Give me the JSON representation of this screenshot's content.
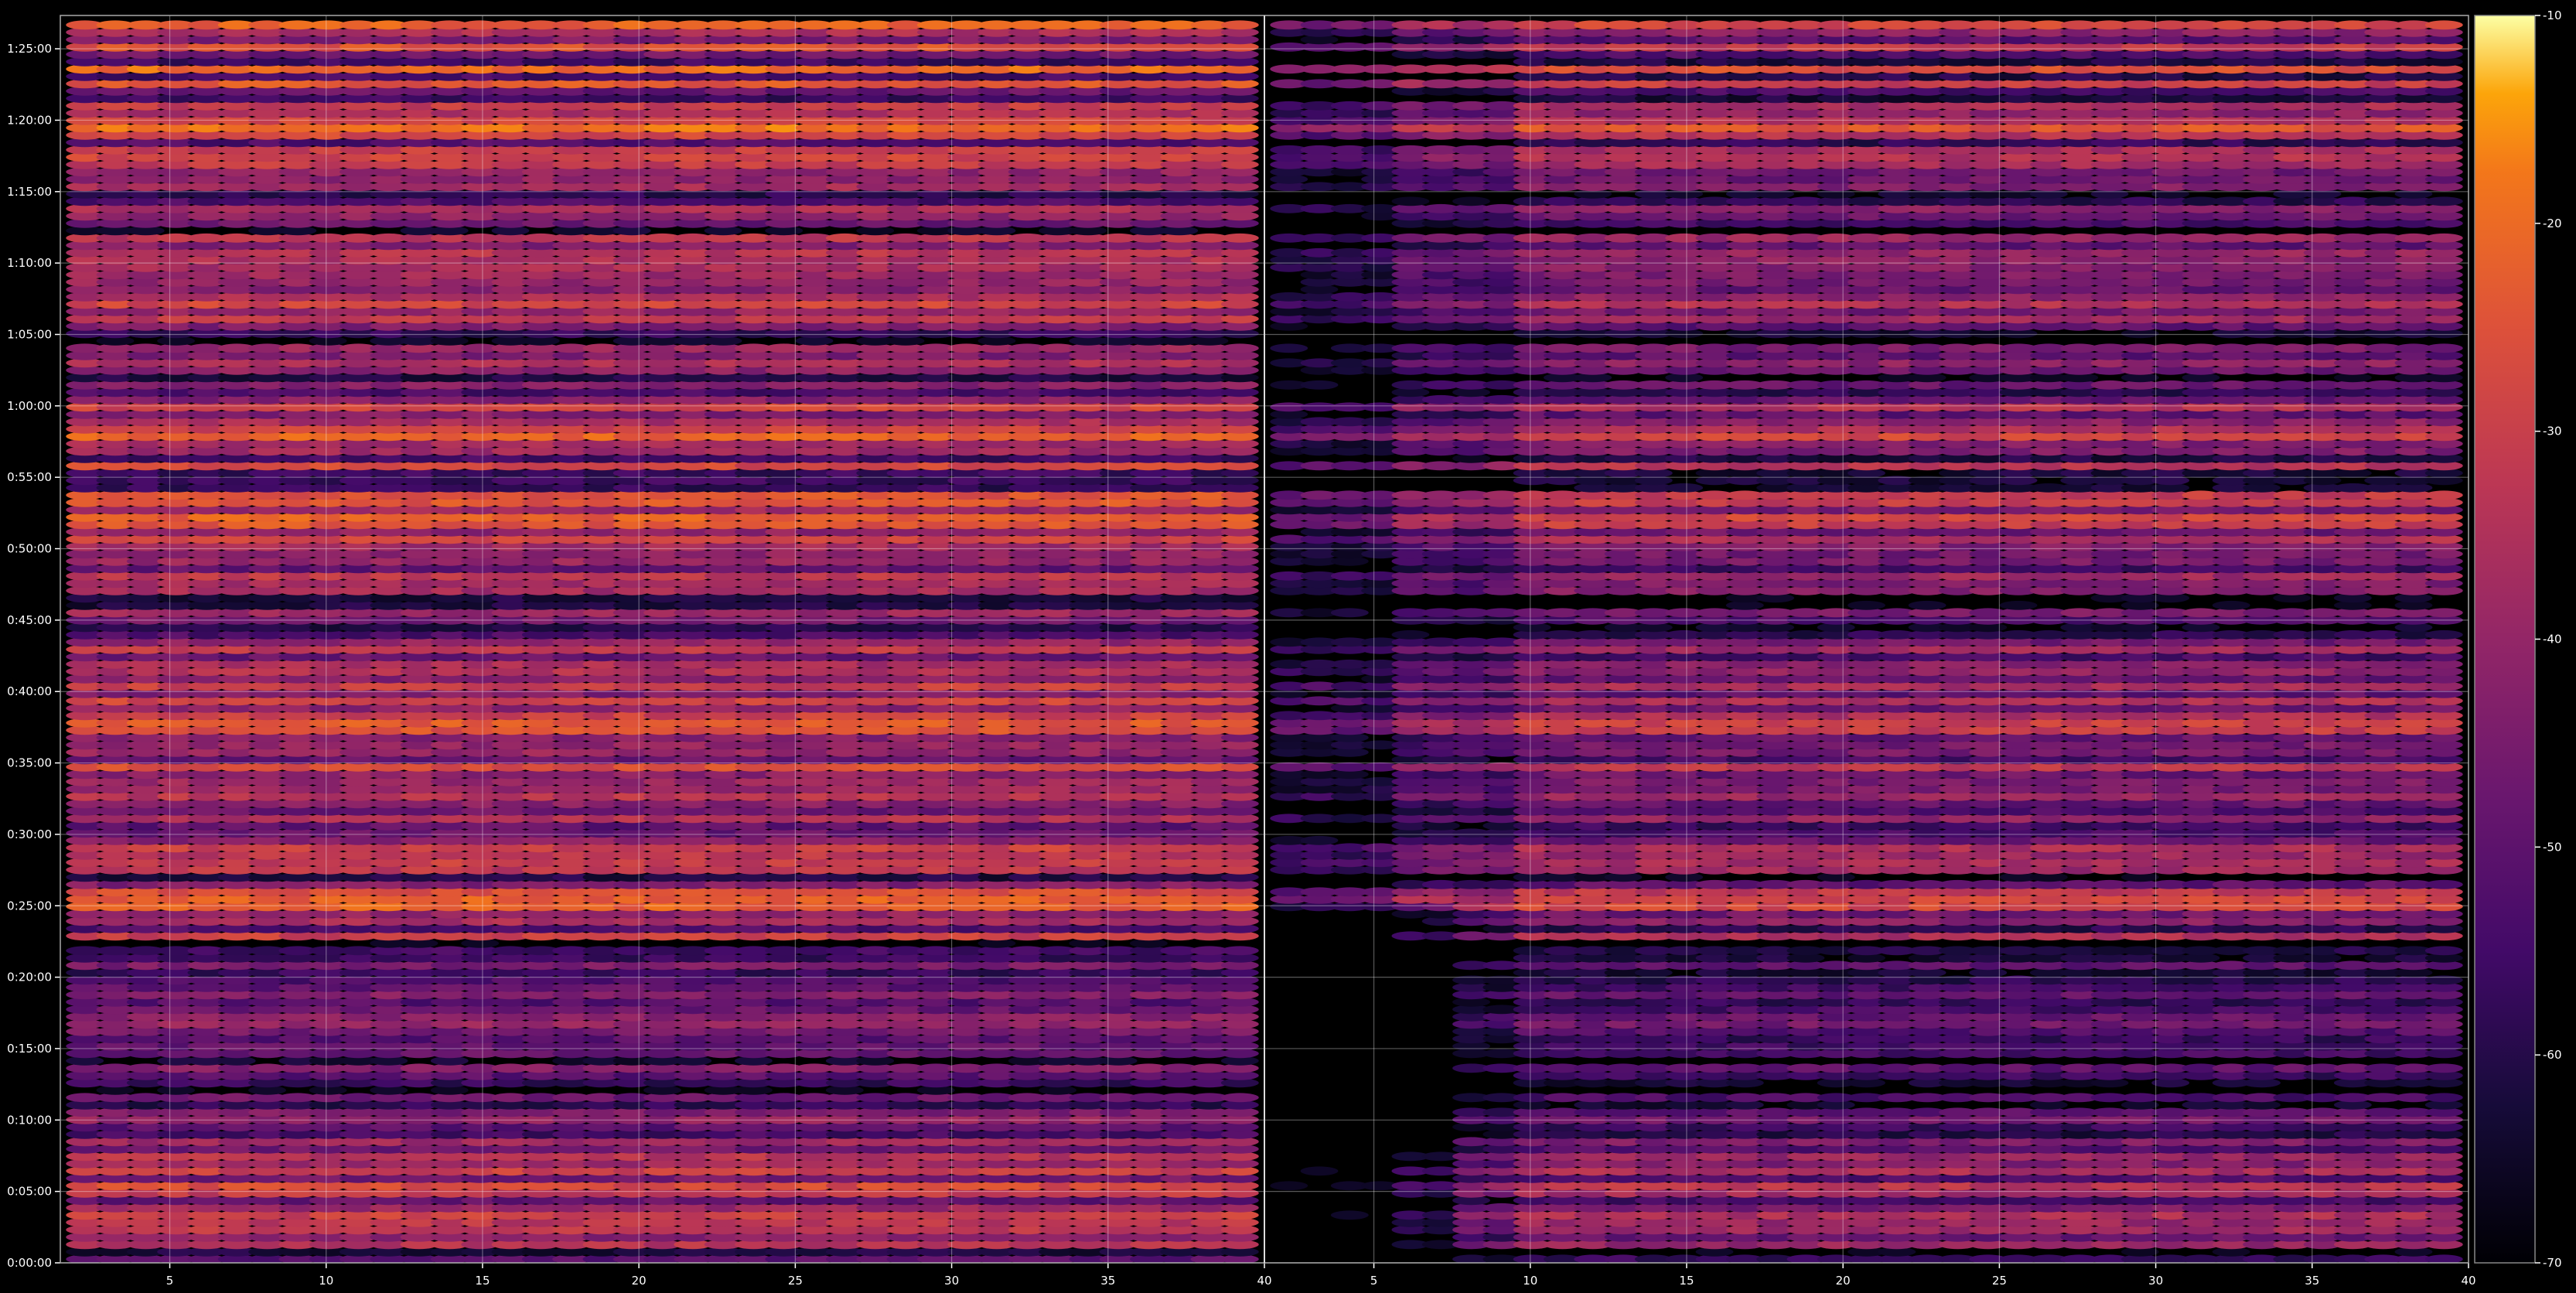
{
  "chart_data": {
    "type": "heatmap",
    "title": "",
    "xlabel": "",
    "ylabel": "",
    "panels": [
      {
        "name": "",
        "x_range": [
          1.5,
          40
        ],
        "x_ticks": [
          5,
          10,
          15,
          20,
          25,
          30,
          35,
          40
        ],
        "x_tick_labels": [
          "5",
          "10",
          "15",
          "20",
          "25",
          "30",
          "35",
          "40"
        ]
      },
      {
        "name": "",
        "x_range": [
          1.5,
          40
        ],
        "x_ticks": [
          5,
          10,
          15,
          20,
          25,
          30,
          35,
          40
        ],
        "x_tick_labels": [
          "5",
          "10",
          "15",
          "20",
          "25",
          "30",
          "35",
          "40"
        ]
      }
    ],
    "y_range_seconds": [
      0,
      5240
    ],
    "y_ticks_seconds": [
      0,
      300,
      600,
      900,
      1200,
      1500,
      1800,
      2100,
      2400,
      2700,
      3000,
      3300,
      3600,
      3900,
      4200,
      4500,
      4800,
      5100
    ],
    "y_tick_labels": [
      "0:00:00",
      "0:05:00",
      "0:10:00",
      "0:15:00",
      "0:20:00",
      "0:25:00",
      "0:30:00",
      "0:35:00",
      "0:40:00",
      "0:45:00",
      "0:50:00",
      "0:55:00",
      "1:00:00",
      "1:05:00",
      "1:10:00",
      "1:15:00",
      "1:20:00",
      "1:25:00"
    ],
    "grid": true,
    "colormap": "inferno",
    "colorbar": {
      "range": [
        -70,
        -10
      ],
      "ticks": [
        -10,
        -20,
        -30,
        -40,
        -50,
        -60,
        -70
      ],
      "tick_labels": [
        "-10",
        "-20",
        "-30",
        "-40",
        "-50",
        "-60",
        "-70"
      ]
    },
    "row_levels": [
      {
        "time": "1:25:00",
        "value": -32
      },
      {
        "time": "1:20:00",
        "value": -25
      },
      {
        "time": "1:15:00",
        "value": -48
      },
      {
        "time": "1:10:00",
        "value": -40
      },
      {
        "time": "1:05:00",
        "value": -38
      },
      {
        "time": "1:00:00",
        "value": -35
      },
      {
        "time": "0:55:00",
        "value": -29
      },
      {
        "time": "0:50:00",
        "value": -33
      },
      {
        "time": "0:45:00",
        "value": -46
      },
      {
        "time": "0:40:00",
        "value": -38
      },
      {
        "time": "0:35:00",
        "value": -30
      },
      {
        "time": "0:30:00",
        "value": -40
      },
      {
        "time": "0:25:00",
        "value": -30
      },
      {
        "time": "0:20:00",
        "value": -55
      },
      {
        "time": "0:15:00",
        "value": -46
      },
      {
        "time": "0:10:00",
        "value": -50
      },
      {
        "time": "0:05:00",
        "value": -35
      },
      {
        "time": "0:00:00",
        "value": -40
      }
    ]
  }
}
